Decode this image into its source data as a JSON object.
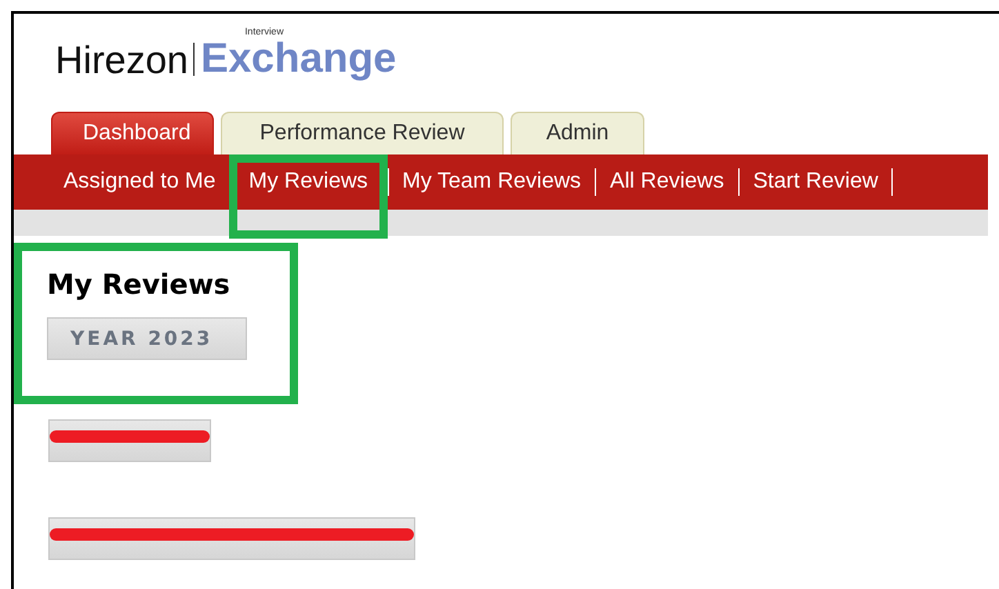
{
  "logo": {
    "brand": "Hirezon",
    "product_small": "Interview",
    "product": "Exchange"
  },
  "tabs": [
    {
      "label": "Dashboard",
      "selected": true
    },
    {
      "label": "Performance Review",
      "selected": false
    },
    {
      "label": "Admin",
      "selected": false
    }
  ],
  "nav": [
    {
      "label": "Assigned to Me",
      "highlighted": false,
      "separator": false
    },
    {
      "label": "My Reviews",
      "highlighted": true,
      "separator": false
    },
    {
      "label": "My Team Reviews",
      "highlighted": false,
      "separator": true
    },
    {
      "label": "All Reviews",
      "highlighted": false,
      "separator": true
    },
    {
      "label": "Start Review",
      "highlighted": false,
      "separator": true
    }
  ],
  "section": {
    "title": "My Reviews",
    "highlighted": true
  },
  "buttons": [
    {
      "label": "YEAR 2023",
      "redacted": false
    },
    {
      "redacted": true
    },
    {
      "redacted": true
    }
  ]
}
